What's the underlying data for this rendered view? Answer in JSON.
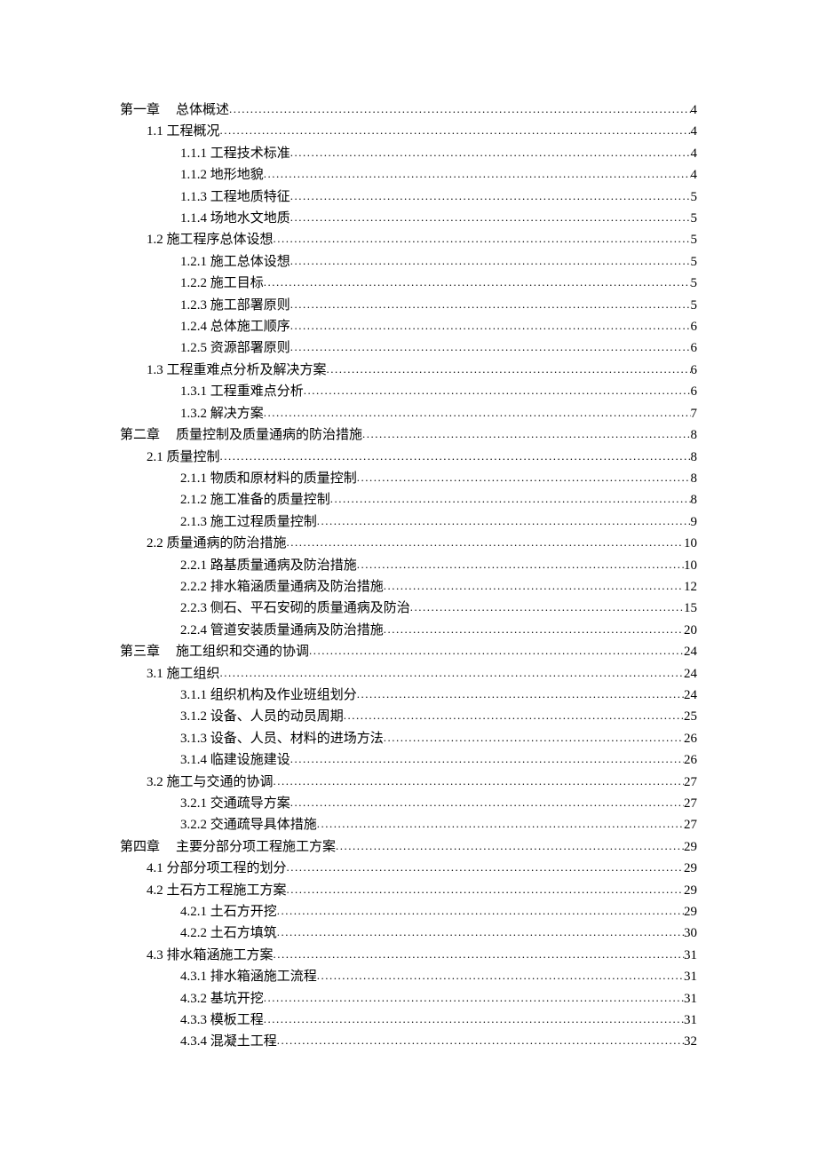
{
  "toc": [
    {
      "level": 0,
      "chapter": "第一章",
      "title": "总体概述",
      "page": "4"
    },
    {
      "level": 1,
      "title": "1.1 工程概况",
      "page": "4"
    },
    {
      "level": 2,
      "title": "1.1.1 工程技术标准",
      "page": "4"
    },
    {
      "level": 2,
      "title": "1.1.2 地形地貌",
      "page": "4"
    },
    {
      "level": 2,
      "title": "1.1.3 工程地质特征",
      "page": "5"
    },
    {
      "level": 2,
      "title": "1.1.4 场地水文地质",
      "page": "5"
    },
    {
      "level": 1,
      "title": "1.2 施工程序总体设想",
      "page": "5"
    },
    {
      "level": 2,
      "title": "1.2.1 施工总体设想",
      "page": "5"
    },
    {
      "level": 2,
      "title": "1.2.2 施工目标",
      "page": "5"
    },
    {
      "level": 2,
      "title": "1.2.3 施工部署原则",
      "page": "5"
    },
    {
      "level": 2,
      "title": "1.2.4 总体施工顺序",
      "page": "6"
    },
    {
      "level": 2,
      "title": "1.2.5 资源部署原则",
      "page": "6"
    },
    {
      "level": 1,
      "title": "1.3 工程重难点分析及解决方案",
      "page": "6"
    },
    {
      "level": 2,
      "title": "1.3.1 工程重难点分析",
      "page": "6"
    },
    {
      "level": 2,
      "title": "1.3.2 解决方案",
      "page": "7"
    },
    {
      "level": 0,
      "chapter": "第二章",
      "title": "质量控制及质量通病的防治措施",
      "page": "8"
    },
    {
      "level": 1,
      "title": "2.1 质量控制",
      "page": "8"
    },
    {
      "level": 2,
      "title": "2.1.1 物质和原材料的质量控制",
      "page": "8"
    },
    {
      "level": 2,
      "title": "2.1.2 施工准备的质量控制",
      "page": "8"
    },
    {
      "level": 2,
      "title": "2.1.3 施工过程质量控制",
      "page": "9"
    },
    {
      "level": 1,
      "title": "2.2 质量通病的防治措施",
      "page": "10"
    },
    {
      "level": 2,
      "title": "2.2.1 路基质量通病及防治措施",
      "page": "10"
    },
    {
      "level": 2,
      "title": "2.2.2 排水箱涵质量通病及防治措施",
      "page": "12"
    },
    {
      "level": 2,
      "title": "2.2.3 侧石、平石安砌的质量通病及防治",
      "page": "15"
    },
    {
      "level": 2,
      "title": "2.2.4 管道安装质量通病及防治措施",
      "page": "20"
    },
    {
      "level": 0,
      "chapter": "第三章",
      "title": "施工组织和交通的协调",
      "page": "24"
    },
    {
      "level": 1,
      "title": "3.1 施工组织",
      "page": "24"
    },
    {
      "level": 2,
      "title": "3.1.1 组织机构及作业班组划分",
      "page": "24"
    },
    {
      "level": 2,
      "title": "3.1.2 设备、人员的动员周期",
      "page": "25"
    },
    {
      "level": 2,
      "title": "3.1.3 设备、人员、材料的进场方法",
      "page": "26"
    },
    {
      "level": 2,
      "title": "3.1.4 临建设施建设",
      "page": "26"
    },
    {
      "level": 1,
      "title": "3.2 施工与交通的协调",
      "page": "27"
    },
    {
      "level": 2,
      "title": "3.2.1 交通疏导方案",
      "page": "27"
    },
    {
      "level": 2,
      "title": "3.2.2 交通疏导具体措施",
      "page": "27"
    },
    {
      "level": 0,
      "chapter": "第四章",
      "title": "主要分部分项工程施工方案",
      "page": "29"
    },
    {
      "level": 1,
      "title": "4.1 分部分项工程的划分",
      "page": "29"
    },
    {
      "level": 1,
      "title": "4.2 土石方工程施工方案",
      "page": "29"
    },
    {
      "level": 2,
      "title": "4.2.1 土石方开挖",
      "page": "29"
    },
    {
      "level": 2,
      "title": "4.2.2 土石方填筑",
      "page": "30"
    },
    {
      "level": 1,
      "title": "4.3 排水箱涵施工方案",
      "page": "31"
    },
    {
      "level": 2,
      "title": "4.3.1 排水箱涵施工流程",
      "page": "31"
    },
    {
      "level": 2,
      "title": "4.3.2 基坑开挖",
      "page": "31"
    },
    {
      "level": 2,
      "title": "4.3.3 模板工程",
      "page": "31"
    },
    {
      "level": 2,
      "title": "4.3.4 混凝土工程",
      "page": "32"
    }
  ]
}
